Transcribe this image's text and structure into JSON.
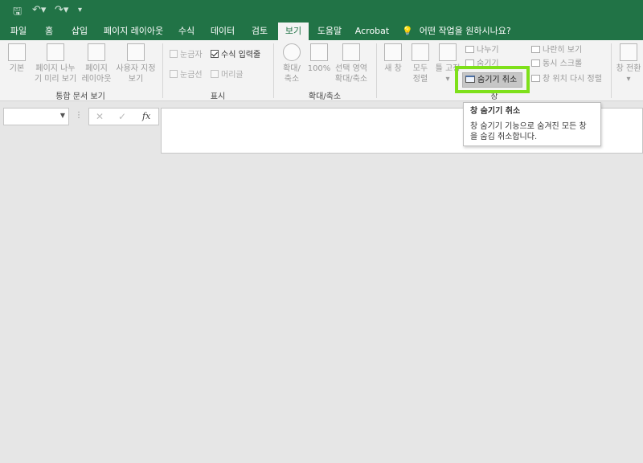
{
  "quick_access": {
    "save_icon": "save-icon",
    "undo_icon": "undo-icon",
    "redo_icon": "redo-icon",
    "customize_icon": "customize-qat-icon"
  },
  "tabs": [
    "파일",
    "홈",
    "삽입",
    "페이지 레이아웃",
    "수식",
    "데이터",
    "검토",
    "보기",
    "도움말",
    "Acrobat"
  ],
  "active_tab": "보기",
  "tell_me": {
    "icon": "lightbulb-icon",
    "text": "어떤 작업을 원하시나요?"
  },
  "ribbon": {
    "workbook_views": {
      "label": "통합 문서 보기",
      "normal": "기본",
      "page_break_1": "페이지 나누",
      "page_break_2": "기 미리 보기",
      "page_layout_1": "페이지",
      "page_layout_2": "레이아웃",
      "custom_1": "사용자 지정",
      "custom_2": "보기"
    },
    "show": {
      "label": "표시",
      "ruler": "눈금자",
      "formula_bar": "수식 입력줄",
      "gridlines": "눈금선",
      "headings": "머리글"
    },
    "zoom": {
      "label": "확대/축소",
      "zoom_1": "확대/",
      "zoom_2": "축소",
      "hundred": "100%",
      "selection_1": "선택 영역",
      "selection_2": "확대/축소"
    },
    "window": {
      "label": "창",
      "new_window": "새 창",
      "arrange_1": "모두",
      "arrange_2": "정렬",
      "freeze": "틀 고정",
      "split": "나누기",
      "hide": "숨기기",
      "unhide": "숨기기 취소",
      "side_by_side": "나란히 보기",
      "sync_scroll": "동시 스크롤",
      "reset_position": "창 위치 다시 정렬",
      "switch": "창 전환"
    }
  },
  "formula_bar": {
    "cancel": "✕",
    "enter": "✓",
    "fx": "fx",
    "dots": "⋮"
  },
  "tooltip": {
    "title": "창 숨기기 취소",
    "description": "창 숨기기 기능으로 숨겨진 모든 창을 숨김 취소합니다."
  },
  "colors": {
    "ribbon_green": "#217346",
    "highlight": "#7ee01a"
  }
}
